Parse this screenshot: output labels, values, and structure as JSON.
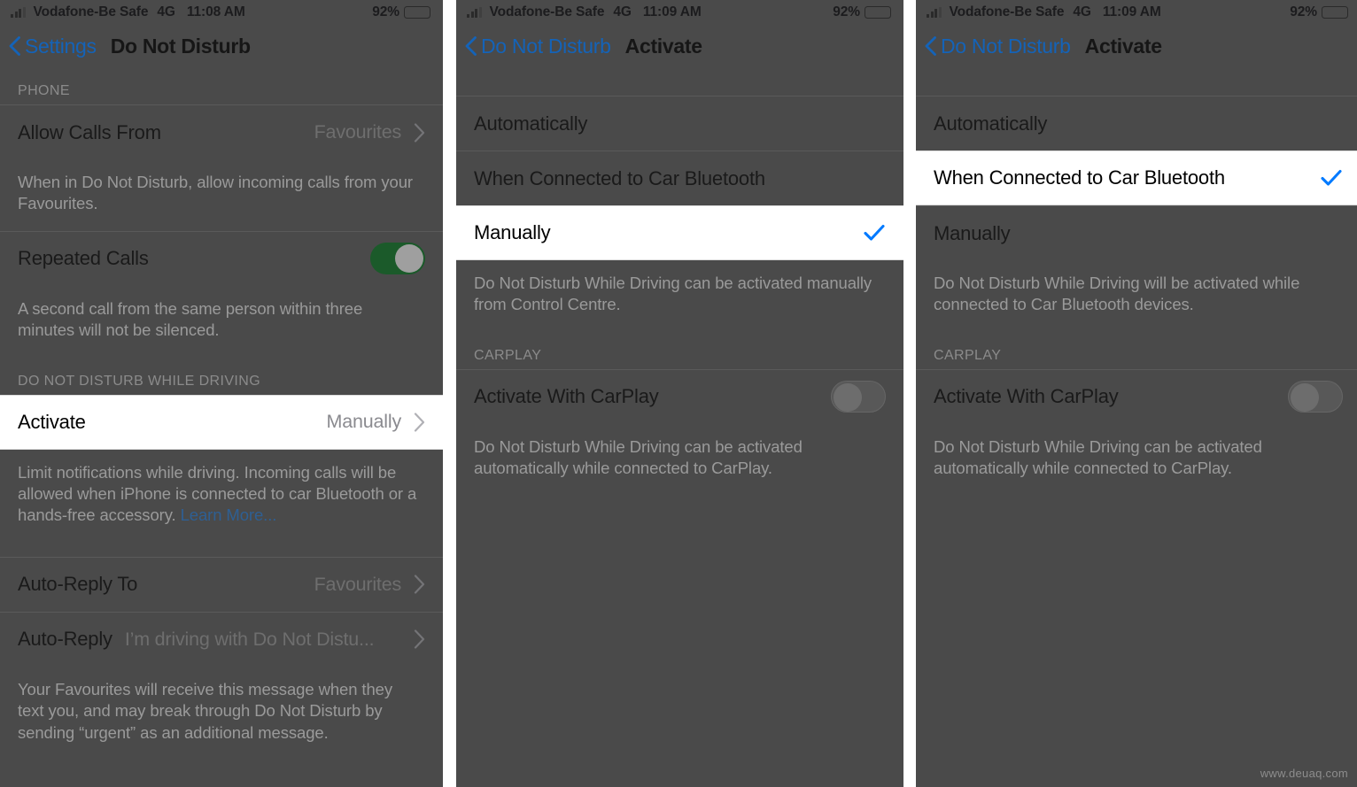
{
  "status_bar": {
    "carrier": "Vodafone-Be Safe",
    "network": "4G",
    "time_panel1": "11:08 AM",
    "time_panel2": "11:09 AM",
    "time_panel3": "11:09 AM",
    "battery_percent": "92%",
    "signal_icon": "signal-bars-icon",
    "battery_icon": "battery-icon"
  },
  "panel1": {
    "back_label": "Settings",
    "title": "Do Not Disturb",
    "section_phone": "PHONE",
    "rows": {
      "allow_calls_label": "Allow Calls From",
      "allow_calls_value": "Favourites",
      "allow_calls_note": "When in Do Not Disturb, allow incoming calls from your Favourites.",
      "repeated_calls_label": "Repeated Calls",
      "repeated_calls_state": "on",
      "repeated_calls_note": "A second call from the same person within three minutes will not be silenced.",
      "section_dnd_driving": "DO NOT DISTURB WHILE DRIVING",
      "activate_label": "Activate",
      "activate_value": "Manually",
      "activate_note_text": "Limit notifications while driving. Incoming calls will be allowed when iPhone is connected to car Bluetooth or a hands-free accessory. ",
      "activate_note_link": "Learn More...",
      "auto_reply_to_label": "Auto-Reply To",
      "auto_reply_to_value": "Favourites",
      "auto_reply_label": "Auto-Reply",
      "auto_reply_value": "I’m driving with Do Not Distu...",
      "auto_reply_note": "Your Favourites will receive this message when they text you, and may break through Do Not Disturb by sending “urgent” as an additional message."
    }
  },
  "panel2": {
    "back_label": "Do Not Disturb",
    "title": "Activate",
    "options": {
      "automatically": "Automatically",
      "when_connected": "When Connected to Car Bluetooth",
      "manually": "Manually",
      "selected": "Manually"
    },
    "note": "Do Not Disturb While Driving can be activated manually from Control Centre.",
    "section_carplay": "CARPLAY",
    "carplay_label": "Activate With CarPlay",
    "carplay_state": "off",
    "carplay_note": "Do Not Disturb While Driving can be activated automatically while connected to CarPlay."
  },
  "panel3": {
    "back_label": "Do Not Disturb",
    "title": "Activate",
    "options": {
      "automatically": "Automatically",
      "when_connected": "When Connected to Car Bluetooth",
      "manually": "Manually",
      "selected": "When Connected to Car Bluetooth"
    },
    "note": "Do Not Disturb While Driving will be activated while connected to Car Bluetooth devices.",
    "section_carplay": "CARPLAY",
    "carplay_label": "Activate With CarPlay",
    "carplay_state": "off",
    "carplay_note": "Do Not Disturb While Driving can be activated automatically while connected to CarPlay."
  },
  "watermark": "www.deuaq.com",
  "colors": {
    "accent_blue": "#007AFF",
    "link_blue": "#1463b8",
    "toggle_on_green": "#34C759",
    "dim_background": "#4a4a4a"
  }
}
